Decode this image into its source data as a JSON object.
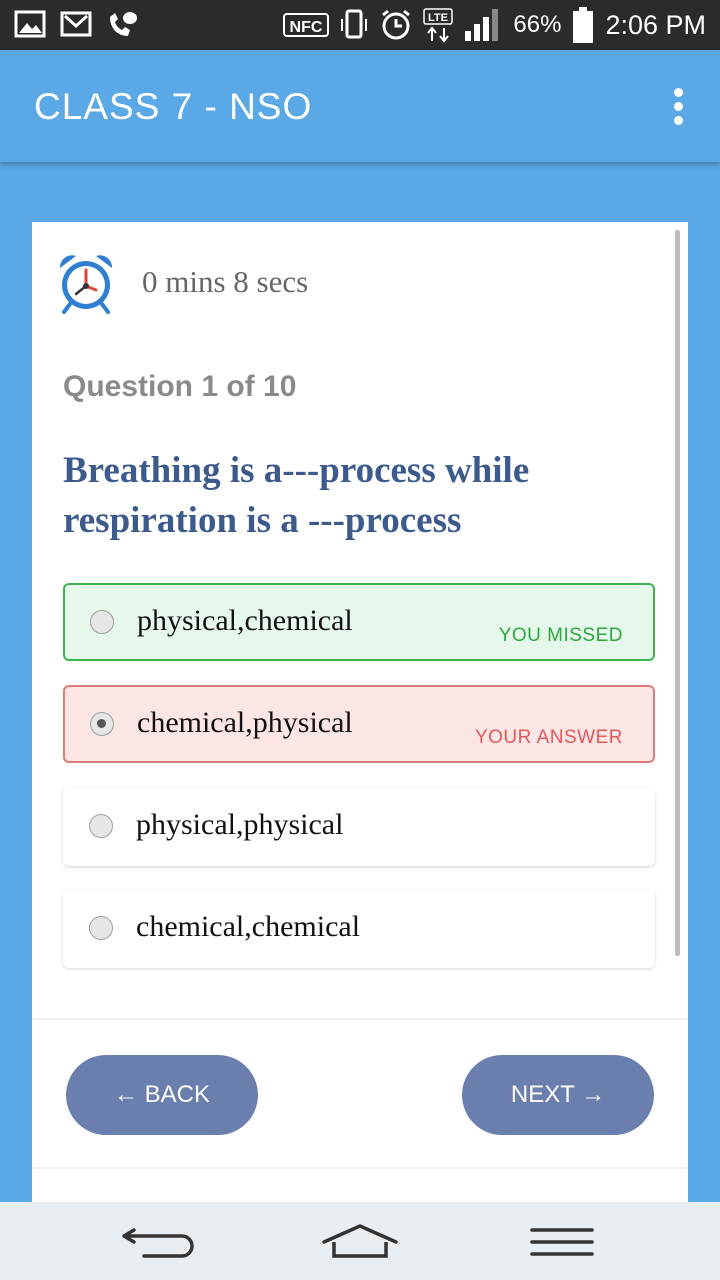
{
  "status_bar": {
    "battery_pct": "66%",
    "time": "2:06 PM",
    "nfc_label": "NFC",
    "lte_label": "LTE"
  },
  "app_bar": {
    "title": "CLASS 7 - NSO"
  },
  "timer": {
    "text": "0 mins 8 secs"
  },
  "question": {
    "counter": "Question 1 of 10",
    "text": "Breathing is a---process while respiration is a ---process"
  },
  "options": [
    {
      "label": "physical,chemical",
      "tag": "YOU MISSED",
      "state": "missed",
      "selected": false
    },
    {
      "label": "chemical,physical",
      "tag": "YOUR ANSWER",
      "state": "wrong",
      "selected": true
    },
    {
      "label": "physical,physical",
      "tag": "",
      "state": "neutral",
      "selected": false
    },
    {
      "label": "chemical,chemical",
      "tag": "",
      "state": "neutral",
      "selected": false
    }
  ],
  "buttons": {
    "back": "← BACK",
    "next": "NEXT →"
  },
  "colors": {
    "primary": "#5aa9e6",
    "question_text": "#3c5a8c",
    "correct": "#3fb34f",
    "wrong": "#e07b7b",
    "button": "#6a7fad"
  }
}
